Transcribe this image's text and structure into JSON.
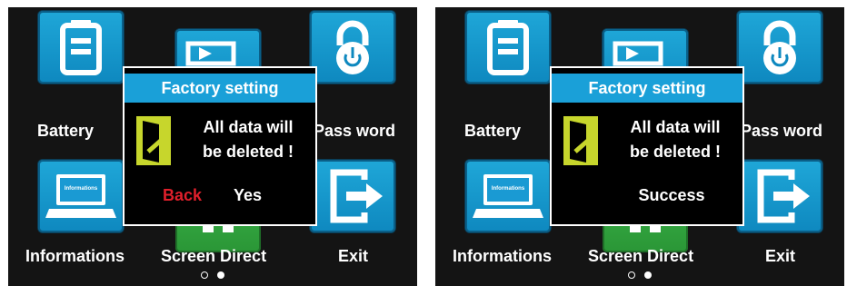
{
  "tiles": {
    "battery": "Battery",
    "password": "Pass word",
    "informations": "Informations",
    "informations_screen_text": "Informations",
    "screen_direct": "Screen Direct",
    "exit": "Exit"
  },
  "pager": {
    "current_page": 2,
    "total_pages": 2
  },
  "dialog_confirm": {
    "title": "Factory setting",
    "message_line1": "All data will",
    "message_line2": "be deleted !",
    "back_label": "Back",
    "yes_label": "Yes"
  },
  "dialog_result": {
    "title": "Factory setting",
    "message_line1": "All data will",
    "message_line2": "be deleted !",
    "status": "Success"
  },
  "colors": {
    "tile_blue": "#1aa0d8",
    "tile_green": "#3cb44a",
    "dialog_title_bg": "#1aa0d8",
    "back_red": "#e01f2b",
    "door_yellow": "#c7d62c"
  }
}
